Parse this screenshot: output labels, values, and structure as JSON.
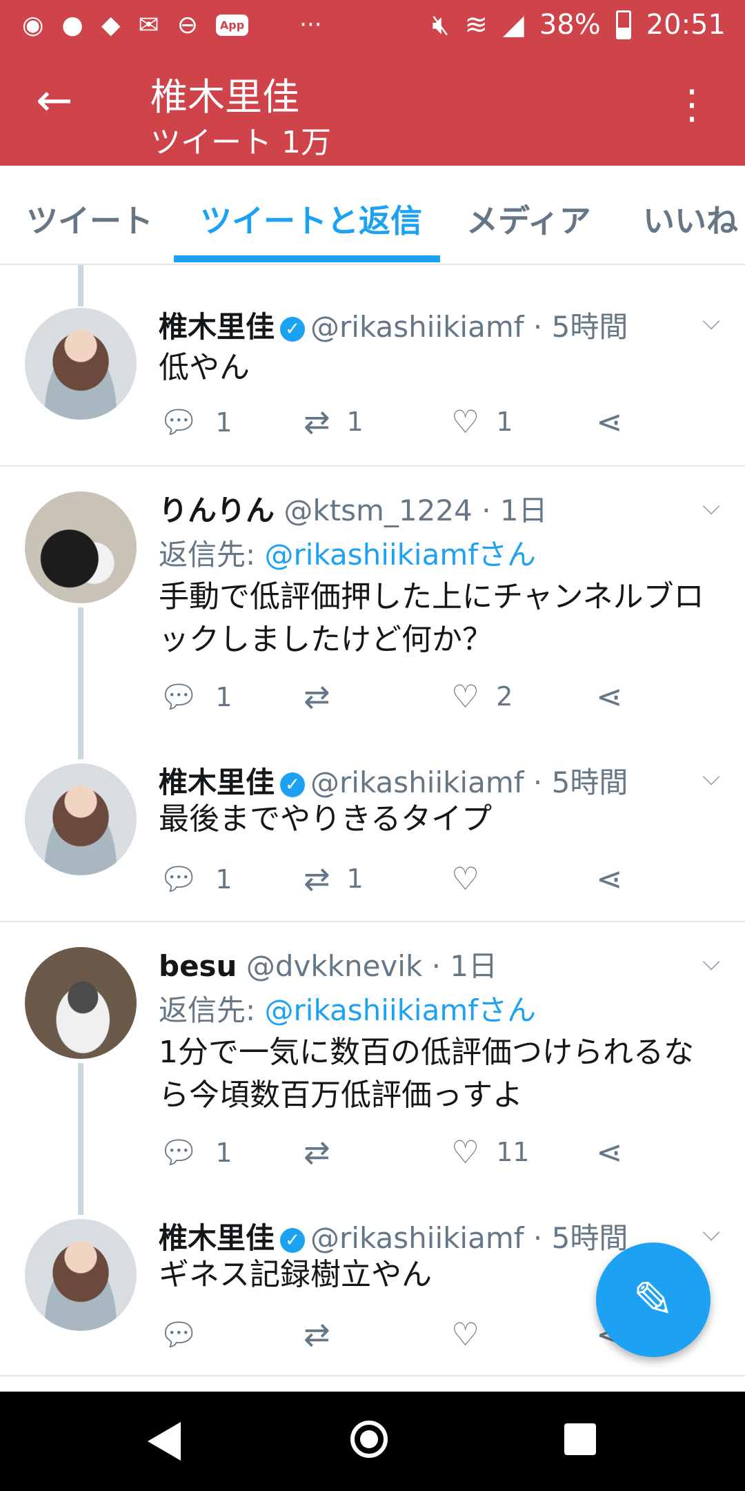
{
  "status_bar": {
    "battery": "38%",
    "time": "20:51",
    "app_badge": "App",
    "overflow": "···"
  },
  "header": {
    "title": "椎木里佳",
    "subtitle": "ツイート 1万"
  },
  "tabs": [
    {
      "label": "ツイート",
      "active": false
    },
    {
      "label": "ツイートと返信",
      "active": true
    },
    {
      "label": "メディア",
      "active": false
    },
    {
      "label": "いいね",
      "active": false
    }
  ],
  "tweets": [
    {
      "name": "椎木里佳",
      "handle": "@rikashiikiamf · 5時間",
      "verified": true,
      "text": [
        "低やん"
      ],
      "replies": "1",
      "retweets": "1",
      "likes": "1"
    },
    {
      "name": "りんりん",
      "handle": "@ktsm_1224 · 1日",
      "verified": false,
      "reply_label": "返信先:",
      "reply_to": "@rikashiikiamfさん",
      "text": [
        "手動で低評価押した上にチャンネルブロ",
        "ックしましたけど何か？"
      ],
      "replies": "1",
      "retweets": "",
      "likes": "2"
    },
    {
      "name": "椎木里佳",
      "handle": "@rikashiikiamf · 5時間",
      "verified": true,
      "text": [
        "最後までやりきるタイプ"
      ],
      "replies": "1",
      "retweets": "1",
      "likes": ""
    },
    {
      "name": "besu",
      "handle": "@dvkknevik · 1日",
      "verified": false,
      "reply_label": "返信先:",
      "reply_to": "@rikashiikiamfさん",
      "text": [
        "1分で一気に数百の低評価つけられるな",
        "ら今頃数百万低評価っすよ"
      ],
      "replies": "1",
      "retweets": "",
      "likes": "11"
    },
    {
      "name": "椎木里佳",
      "handle": "@rikashiikiamf · 5時間",
      "verified": true,
      "text": [
        "ギネス記録樹立やん"
      ],
      "replies": "",
      "retweets": "",
      "likes": ""
    }
  ],
  "colors": {
    "header_bg": "#cf434b",
    "accent": "#1da1f2"
  }
}
